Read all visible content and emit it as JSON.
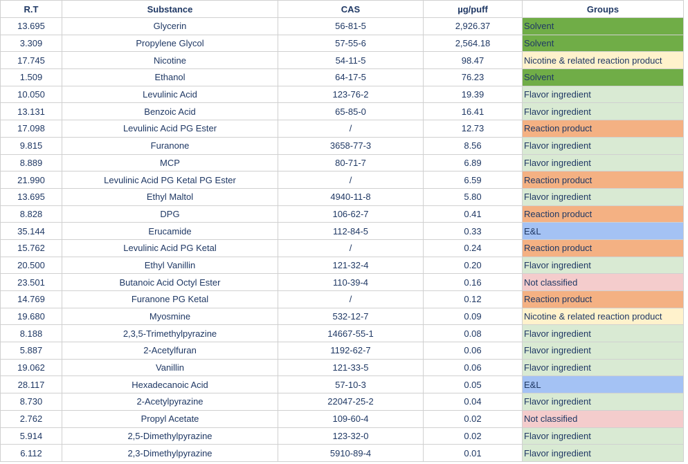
{
  "headers": [
    "R.T",
    "Substance",
    "CAS",
    "µg/puff",
    "Groups"
  ],
  "group_colors": {
    "Solvent": "#70ad47",
    "Nicotine & related reaction product": "#fff2cc",
    "Flavor ingredient": "#d9ead3",
    "Reaction product": "#f4b183",
    "E&L": "#a4c2f4",
    "Not classified": "#f4cccc"
  },
  "rows": [
    {
      "rt": "13.695",
      "substance": "Glycerin",
      "cas": "56-81-5",
      "ug": "2,926.37",
      "group": "Solvent"
    },
    {
      "rt": "3.309",
      "substance": "Propylene Glycol",
      "cas": "57-55-6",
      "ug": "2,564.18",
      "group": "Solvent"
    },
    {
      "rt": "17.745",
      "substance": "Nicotine",
      "cas": "54-11-5",
      "ug": "98.47",
      "group": "Nicotine & related reaction product"
    },
    {
      "rt": "1.509",
      "substance": "Ethanol",
      "cas": "64-17-5",
      "ug": "76.23",
      "group": "Solvent"
    },
    {
      "rt": "10.050",
      "substance": "Levulinic Acid",
      "cas": "123-76-2",
      "ug": "19.39",
      "group": "Flavor ingredient"
    },
    {
      "rt": "13.131",
      "substance": "Benzoic Acid",
      "cas": "65-85-0",
      "ug": "16.41",
      "group": "Flavor ingredient"
    },
    {
      "rt": "17.098",
      "substance": "Levulinic Acid PG Ester",
      "cas": "/",
      "ug": "12.73",
      "group": "Reaction product"
    },
    {
      "rt": "9.815",
      "substance": "Furanone",
      "cas": "3658-77-3",
      "ug": "8.56",
      "group": "Flavor ingredient"
    },
    {
      "rt": "8.889",
      "substance": "MCP",
      "cas": "80-71-7",
      "ug": "6.89",
      "group": "Flavor ingredient"
    },
    {
      "rt": "21.990",
      "substance": "Levulinic Acid PG Ketal PG Ester",
      "cas": "/",
      "ug": "6.59",
      "group": "Reaction product"
    },
    {
      "rt": "13.695",
      "substance": "Ethyl Maltol",
      "cas": "4940-11-8",
      "ug": "5.80",
      "group": "Flavor ingredient"
    },
    {
      "rt": "8.828",
      "substance": "DPG",
      "cas": "106-62-7",
      "ug": "0.41",
      "group": "Reaction product"
    },
    {
      "rt": "35.144",
      "substance": "Erucamide",
      "cas": "112-84-5",
      "ug": "0.33",
      "group": "E&L"
    },
    {
      "rt": "15.762",
      "substance": "Levulinic Acid PG Ketal",
      "cas": "/",
      "ug": "0.24",
      "group": "Reaction product"
    },
    {
      "rt": "20.500",
      "substance": "Ethyl Vanillin",
      "cas": "121-32-4",
      "ug": "0.20",
      "group": "Flavor ingredient"
    },
    {
      "rt": "23.501",
      "substance": "Butanoic Acid Octyl Ester",
      "cas": "110-39-4",
      "ug": "0.16",
      "group": "Not classified"
    },
    {
      "rt": "14.769",
      "substance": "Furanone PG Ketal",
      "cas": "/",
      "ug": "0.12",
      "group": "Reaction product",
      "tall": true
    },
    {
      "rt": "19.680",
      "substance": "Myosmine",
      "cas": "532-12-7",
      "ug": "0.09",
      "group": "Nicotine & related reaction product"
    },
    {
      "rt": "8.188",
      "substance": "2,3,5-Trimethylpyrazine",
      "cas": "14667-55-1",
      "ug": "0.08",
      "group": "Flavor ingredient"
    },
    {
      "rt": "5.887",
      "substance": "2-Acetylfuran",
      "cas": "1192-62-7",
      "ug": "0.06",
      "group": "Flavor ingredient"
    },
    {
      "rt": "19.062",
      "substance": "Vanillin",
      "cas": "121-33-5",
      "ug": "0.06",
      "group": "Flavor ingredient"
    },
    {
      "rt": "28.117",
      "substance": "Hexadecanoic Acid",
      "cas": "57-10-3",
      "ug": "0.05",
      "group": "E&L"
    },
    {
      "rt": "8.730",
      "substance": "2-Acetylpyrazine",
      "cas": "22047-25-2",
      "ug": "0.04",
      "group": "Flavor ingredient"
    },
    {
      "rt": "2.762",
      "substance": "Propyl Acetate",
      "cas": "109-60-4",
      "ug": "0.02",
      "group": "Not classified"
    },
    {
      "rt": "5.914",
      "substance": "2,5-Dimethylpyrazine",
      "cas": "123-32-0",
      "ug": "0.02",
      "group": "Flavor ingredient"
    },
    {
      "rt": "6.112",
      "substance": "2,3-Dimethylpyrazine",
      "cas": "5910-89-4",
      "ug": "0.01",
      "group": "Flavor ingredient"
    }
  ]
}
